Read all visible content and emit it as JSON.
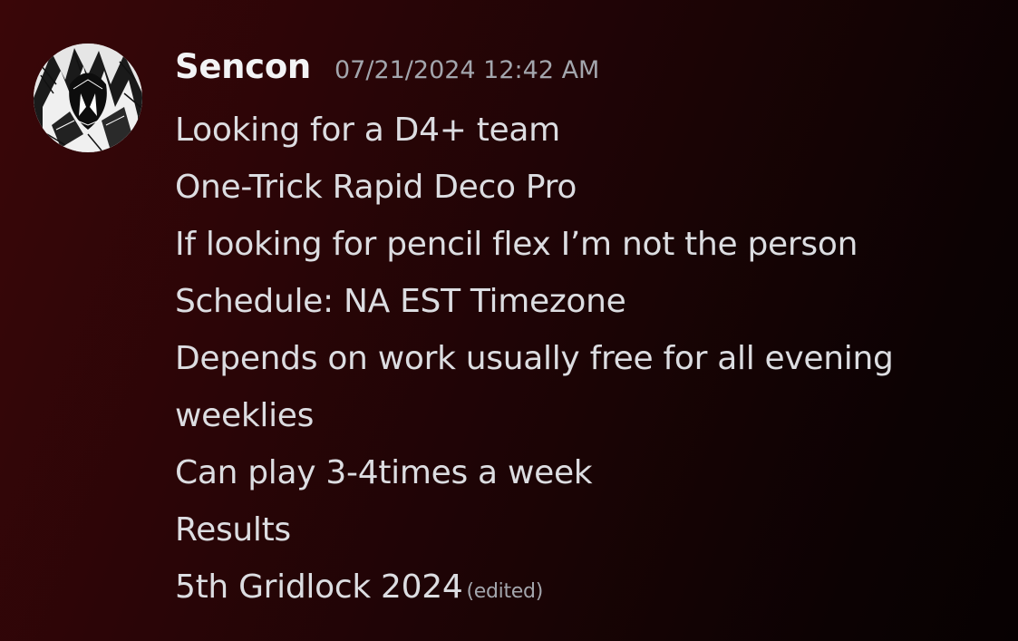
{
  "message": {
    "username": "Sencon",
    "timestamp": "07/21/2024 12:42 AM",
    "lines": [
      "Looking for a D4+ team",
      "One-Trick Rapid Deco Pro",
      "If looking for pencil flex I’m not the person",
      "Schedule: NA EST Timezone",
      "Depends on work usually free for all evening",
      "weeklies",
      "Can play 3-4times a week",
      "Results",
      "5th Gridlock 2024"
    ],
    "edited_label": "(edited)",
    "avatar_icon": "user-avatar-icon"
  },
  "colors": {
    "username": "#f2f3f5",
    "timestamp": "#a3a6ad",
    "text": "#dcdde1",
    "background_start": "#3a0608",
    "background_end": "#070102"
  }
}
